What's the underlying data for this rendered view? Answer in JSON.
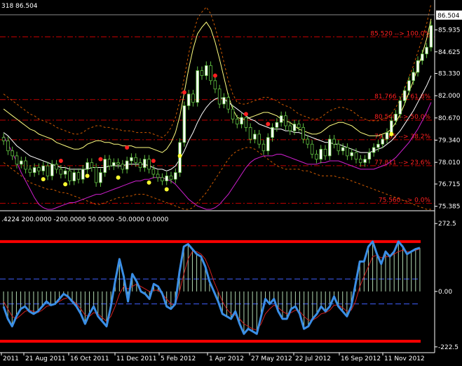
{
  "chart_data": {
    "type": "candlestick",
    "price_header": "318 86.504",
    "indicator_header": ".4224 200.0000 -200.0000 50.0000 -50.0000 0.0000",
    "last_price_label": "86.504",
    "price_ticks": [
      "85.935",
      "84.625",
      "83.330",
      "82.000",
      "80.670",
      "79.340",
      "78.010",
      "76.715",
      "75.385"
    ],
    "price_axis_range": [
      75.2,
      86.8
    ],
    "x_tick_labels": [
      "2011",
      "21 Aug 2011",
      "16 Oct 2011",
      "11 Dec 2011",
      "5 Feb 2012",
      "1 Apr 2012",
      "27 May 2012",
      "22 Jul 2012",
      "16 Sep 2012",
      "11 Nov 2012"
    ],
    "fib_levels": [
      {
        "price": 85.52,
        "label": "85.520 --> 100.0%"
      },
      {
        "price": 81.766,
        "label": "81.766 --> 61.8%"
      },
      {
        "price": 80.54,
        "label": "80.540 --> 50.0%"
      },
      {
        "price": 79.365,
        "label": "79.365 --> 38.2%"
      },
      {
        "price": 77.811,
        "label": "77.811 --> 23.6%"
      },
      {
        "price": 75.56,
        "label": "75.560 --> 0.0%"
      }
    ],
    "close": [
      79.3,
      78.7,
      78.4,
      77.9,
      78.1,
      77.6,
      77.4,
      77.7,
      77.5,
      77.8,
      77.2,
      77.9,
      77.6,
      77.3,
      77.5,
      76.9,
      77.4,
      77.0,
      77.6,
      78.0,
      77.7,
      76.8,
      77.4,
      78.2,
      77.8,
      78.0,
      77.9,
      77.6,
      78.1,
      78.3,
      78.0,
      77.7,
      78.2,
      77.6,
      77.3,
      77.1,
      76.9,
      77.2,
      77.0,
      77.4,
      79.2,
      81.4,
      82.1,
      81.6,
      83.5,
      83.2,
      83.8,
      82.9,
      82.4,
      81.5,
      81.9,
      81.2,
      80.6,
      80.3,
      80.7,
      80.1,
      79.4,
      79.7,
      79.1,
      78.7,
      79.5,
      80.1,
      80.4,
      80.8,
      80.2,
      79.9,
      80.3,
      80.1,
      79.4,
      79.1,
      78.5,
      78.2,
      78.8,
      78.4,
      79.4,
      79.1,
      78.7,
      78.9,
      78.4,
      78.6,
      78.2,
      78.0,
      78.2,
      78.6,
      78.9,
      79.1,
      79.4,
      79.8,
      80.5,
      80.9,
      81.7,
      82.3,
      82.9,
      83.4,
      84.1,
      84.5,
      84.9,
      86.2
    ],
    "bb_upper": [
      81.2,
      81.0,
      80.8,
      80.6,
      80.4,
      80.2,
      80.0,
      79.9,
      79.7,
      79.6,
      79.5,
      79.4,
      79.2,
      79.1,
      79.0,
      78.9,
      78.8,
      78.8,
      78.9,
      79.1,
      79.2,
      79.3,
      79.3,
      79.2,
      79.2,
      79.1,
      79.1,
      79.0,
      79.0,
      79.0,
      78.9,
      78.9,
      78.9,
      78.9,
      78.8,
      78.7,
      78.6,
      78.8,
      79.2,
      79.8,
      80.8,
      82.2,
      83.6,
      84.8,
      85.7,
      86.1,
      86.4,
      86.0,
      85.2,
      84.2,
      83.1,
      82.0,
      81.2,
      80.7,
      80.6,
      80.6,
      80.7,
      80.8,
      80.9,
      81.0,
      81.0,
      80.9,
      80.8,
      80.6,
      80.5,
      80.4,
      80.2,
      80.0,
      79.9,
      79.8,
      79.7,
      79.7,
      79.8,
      80.0,
      80.2,
      80.3,
      80.4,
      80.4,
      80.3,
      80.2,
      80.0,
      79.8,
      79.7,
      79.6,
      79.6,
      79.6,
      79.7,
      79.8,
      80.0,
      80.4,
      80.9,
      81.5,
      82.2,
      82.9,
      83.7,
      84.5,
      85.4,
      86.6
    ],
    "bb_middle": [
      79.8,
      79.6,
      79.3,
      79.0,
      78.8,
      78.6,
      78.4,
      78.3,
      78.2,
      78.1,
      78.0,
      77.9,
      77.8,
      77.7,
      77.7,
      77.6,
      77.6,
      77.6,
      77.6,
      77.6,
      77.7,
      77.7,
      77.7,
      77.7,
      77.8,
      77.8,
      77.8,
      77.8,
      77.9,
      77.9,
      77.9,
      77.9,
      77.9,
      77.8,
      77.7,
      77.6,
      77.6,
      77.5,
      77.6,
      77.8,
      78.2,
      78.7,
      79.3,
      79.8,
      80.4,
      80.9,
      81.3,
      81.6,
      81.8,
      81.9,
      81.8,
      81.6,
      81.4,
      81.2,
      81.0,
      80.8,
      80.6,
      80.5,
      80.3,
      80.2,
      80.1,
      80.0,
      80.0,
      80.0,
      79.9,
      79.9,
      79.8,
      79.8,
      79.7,
      79.6,
      79.5,
      79.4,
      79.3,
      79.2,
      79.2,
      79.1,
      79.1,
      79.0,
      78.9,
      78.8,
      78.7,
      78.6,
      78.6,
      78.6,
      78.7,
      78.8,
      78.9,
      79.1,
      79.3,
      79.6,
      79.9,
      80.3,
      80.7,
      81.1,
      81.6,
      82.1,
      82.6,
      83.2
    ],
    "bb_lower": [
      78.0,
      77.8,
      77.6,
      77.4,
      77.2,
      77.0,
      76.8,
      76.7,
      76.6,
      76.5,
      76.4,
      76.4,
      76.3,
      76.2,
      76.2,
      76.1,
      76.0,
      75.9,
      75.8,
      75.7,
      75.6,
      75.5,
      75.5,
      75.6,
      75.7,
      75.8,
      75.9,
      75.9,
      76.0,
      76.0,
      76.1,
      76.1,
      76.1,
      76.0,
      75.9,
      75.8,
      75.7,
      75.6,
      75.5,
      75.4,
      75.3,
      75.2,
      75.2,
      75.3,
      75.6,
      75.9,
      76.2,
      76.6,
      77.0,
      77.4,
      77.8,
      78.2,
      78.5,
      78.7,
      78.8,
      78.9,
      78.9,
      78.8,
      78.6,
      78.4,
      78.2,
      78.0,
      77.8,
      77.7,
      77.6,
      77.6,
      77.6,
      77.6,
      77.5,
      77.5,
      77.4,
      77.3,
      77.2,
      77.2,
      77.2,
      77.2,
      77.1,
      77.1,
      77.0,
      76.9,
      76.8,
      76.7,
      76.6,
      76.5,
      76.4,
      76.3,
      76.2,
      76.1,
      76.0,
      75.9,
      75.8,
      75.7,
      75.6,
      75.5,
      75.4,
      75.3,
      75.2,
      75.2
    ],
    "magenta_line": [
      79.6,
      79.1,
      78.6,
      78.0,
      77.4,
      76.9,
      76.4,
      75.9,
      75.5,
      75.3,
      75.2,
      75.2,
      75.3,
      75.4,
      75.5,
      75.6,
      75.6,
      75.7,
      75.8,
      75.9,
      76.0,
      76.1,
      76.1,
      76.2,
      76.3,
      76.4,
      76.5,
      76.6,
      76.7,
      76.8,
      76.9,
      76.9,
      77.0,
      77.0,
      77.1,
      77.1,
      77.1,
      77.0,
      76.9,
      76.7,
      76.4,
      76.1,
      75.8,
      75.6,
      75.4,
      75.3,
      75.2,
      75.2,
      75.3,
      75.5,
      75.8,
      76.1,
      76.5,
      76.9,
      77.3,
      77.7,
      78.0,
      78.2,
      78.3,
      78.4,
      78.4,
      78.4,
      78.5,
      78.5,
      78.4,
      78.3,
      78.2,
      78.1,
      78.0,
      77.9,
      77.9,
      77.9,
      78.0,
      78.0,
      78.1,
      78.1,
      78.1,
      78.0,
      77.9,
      77.8,
      77.7,
      77.6,
      77.6,
      77.6,
      77.6,
      77.7,
      77.8,
      77.9,
      78.1,
      78.3,
      78.6,
      78.9,
      79.2,
      79.6,
      80.0,
      80.5,
      81.0,
      81.6
    ],
    "red_markers_index": [
      13,
      22,
      28,
      34,
      41,
      48,
      55,
      60
    ],
    "yellow_markers_index": [
      9,
      14,
      19,
      26,
      33,
      37,
      40,
      88
    ],
    "indicator_axis": {
      "ticks": [
        "272.5",
        "0.00",
        "-222.5"
      ],
      "range": [
        -240,
        290
      ]
    },
    "indicator_levels": {
      "upper_red": 200,
      "lower_red": -200,
      "upper_dash": 50,
      "lower_dash": -50,
      "zero": 0
    },
    "cci_main": [
      -60,
      -110,
      -140,
      -100,
      -70,
      -60,
      -80,
      -90,
      -80,
      -60,
      -40,
      -55,
      -50,
      -30,
      -10,
      -20,
      -40,
      -60,
      -90,
      -130,
      -90,
      -60,
      -100,
      -120,
      -140,
      -60,
      40,
      130,
      60,
      -40,
      70,
      40,
      0,
      -10,
      -30,
      30,
      20,
      -10,
      -60,
      -70,
      -50,
      80,
      180,
      190,
      170,
      150,
      140,
      100,
      40,
      0,
      -40,
      -90,
      -100,
      -110,
      -80,
      -130,
      -170,
      -150,
      -160,
      -170,
      -100,
      -30,
      -50,
      -30,
      -80,
      -110,
      -110,
      -70,
      -60,
      -90,
      -150,
      -140,
      -110,
      -90,
      -60,
      -80,
      -60,
      -20,
      -60,
      -80,
      -100,
      -60,
      30,
      120,
      120,
      180,
      200,
      150,
      110,
      160,
      140,
      160,
      200,
      180,
      150,
      160,
      170,
      175
    ],
    "cci_signal": [
      -40,
      -70,
      -100,
      -110,
      -95,
      -80,
      -75,
      -80,
      -85,
      -75,
      -60,
      -55,
      -50,
      -40,
      -30,
      -25,
      -35,
      -50,
      -70,
      -95,
      -100,
      -85,
      -90,
      -105,
      -120,
      -100,
      -60,
      -10,
      20,
      10,
      20,
      30,
      20,
      10,
      0,
      5,
      5,
      -10,
      -30,
      -50,
      -55,
      0,
      70,
      130,
      160,
      160,
      150,
      130,
      90,
      40,
      0,
      -40,
      -70,
      -90,
      -95,
      -110,
      -130,
      -140,
      -150,
      -155,
      -130,
      -90,
      -70,
      -55,
      -65,
      -80,
      -90,
      -85,
      -75,
      -80,
      -100,
      -115,
      -115,
      -105,
      -90,
      -85,
      -75,
      -55,
      -55,
      -65,
      -80,
      -75,
      -40,
      20,
      60,
      100,
      140,
      145,
      135,
      140,
      140,
      150,
      160,
      165,
      160,
      160,
      165,
      170
    ]
  }
}
